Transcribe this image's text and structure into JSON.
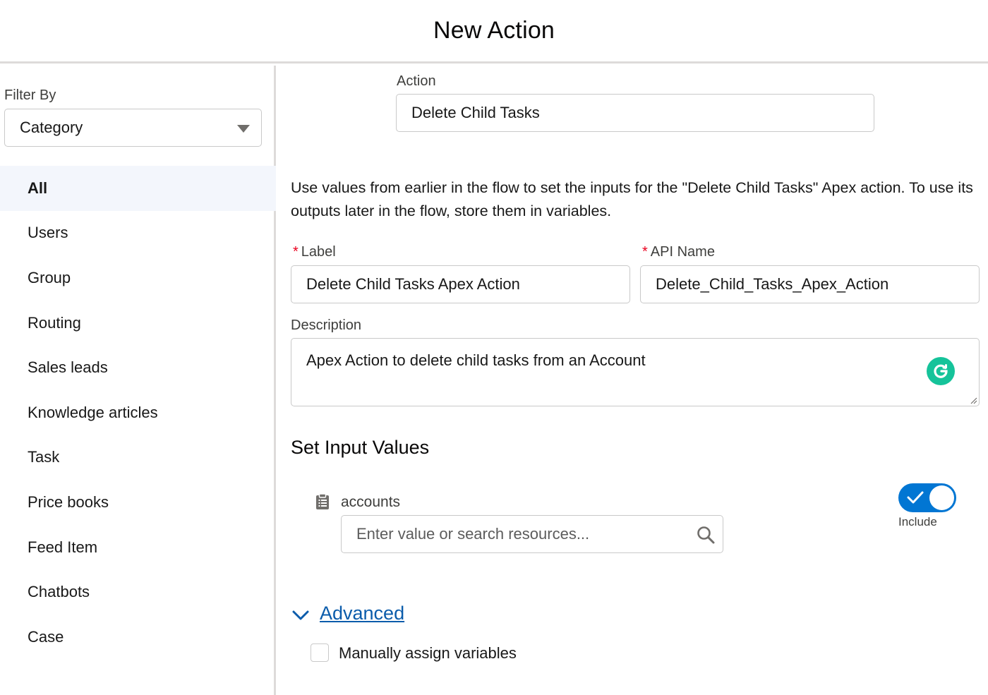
{
  "header": {
    "title": "New Action"
  },
  "sidebar": {
    "filter_label": "Filter By",
    "filter_value": "Category",
    "items": [
      {
        "label": "All",
        "active": true
      },
      {
        "label": "Users"
      },
      {
        "label": "Group"
      },
      {
        "label": "Routing"
      },
      {
        "label": "Sales leads"
      },
      {
        "label": "Knowledge articles"
      },
      {
        "label": "Task"
      },
      {
        "label": "Price books"
      },
      {
        "label": "Feed Item"
      },
      {
        "label": "Chatbots"
      },
      {
        "label": "Case"
      }
    ]
  },
  "main": {
    "action_label": "Action",
    "action_value": "Delete Child Tasks",
    "intro": "Use values from earlier in the flow to set the inputs for the \"Delete Child Tasks\" Apex action. To use its outputs later in the flow, store them in variables.",
    "required_marker": "*",
    "label_field": {
      "label": "Label",
      "value": "Delete Child Tasks Apex Action"
    },
    "api_field": {
      "label": "API Name",
      "value": "Delete_Child_Tasks_Apex_Action"
    },
    "description": {
      "label": "Description",
      "value": "Apex Action to delete child tasks from an Account"
    },
    "inputs_title": "Set Input Values",
    "input_param": {
      "name": "accounts",
      "placeholder": "Enter value or search resources...",
      "include_label": "Include",
      "include_on": true
    },
    "advanced": {
      "label": "Advanced",
      "manual_assign_label": "Manually assign variables",
      "manual_assign_checked": false
    }
  },
  "colors": {
    "brand": "#0176d3",
    "link": "#0b5cab",
    "required": "#ea001e",
    "active_row": "#f3f6fc",
    "grammarly": "#15c39a"
  }
}
